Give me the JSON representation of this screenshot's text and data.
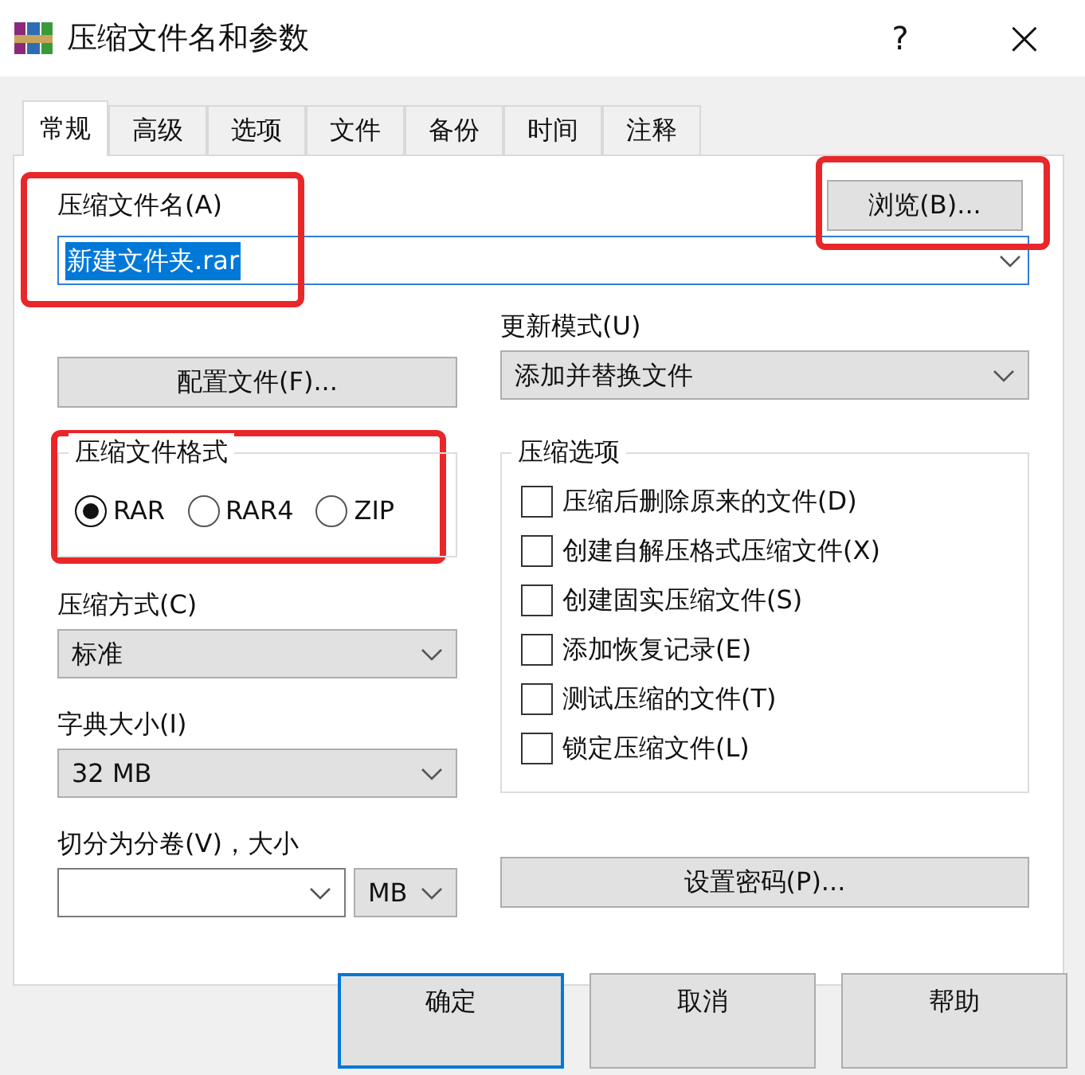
{
  "window": {
    "title": "压缩文件名和参数",
    "help": "?",
    "close": "×"
  },
  "tabs": [
    {
      "label": "常规",
      "selected": true
    },
    {
      "label": "高级",
      "selected": false
    },
    {
      "label": "选项",
      "selected": false
    },
    {
      "label": "文件",
      "selected": false
    },
    {
      "label": "备份",
      "selected": false
    },
    {
      "label": "时间",
      "selected": false
    },
    {
      "label": "注释",
      "selected": false
    }
  ],
  "archive_name": {
    "label": "压缩文件名(A)",
    "value": "新建文件夹.rar",
    "highlighted": true
  },
  "browse_button": {
    "label": "浏览(B)...",
    "highlighted": true
  },
  "profiles_button": {
    "label": "配置文件(F)..."
  },
  "update_mode": {
    "label": "更新模式(U)",
    "value": "添加并替换文件"
  },
  "archive_format": {
    "label": "压缩文件格式",
    "highlighted": true,
    "options": [
      {
        "label": "RAR",
        "selected": true
      },
      {
        "label": "RAR4",
        "selected": false
      },
      {
        "label": "ZIP",
        "selected": false
      }
    ]
  },
  "compression_method": {
    "label": "压缩方式(C)",
    "value": "标准"
  },
  "dictionary_size": {
    "label": "字典大小(I)",
    "value": "32 MB"
  },
  "split_volumes": {
    "label": "切分为分卷(V)，大小",
    "unit": "MB"
  },
  "archiving_options": {
    "label": "压缩选项",
    "items": [
      {
        "label": "压缩后删除原来的文件(D)",
        "checked": false
      },
      {
        "label": "创建自解压格式压缩文件(X)",
        "checked": false
      },
      {
        "label": "创建固实压缩文件(S)",
        "checked": false
      },
      {
        "label": "添加恢复记录(E)",
        "checked": false
      },
      {
        "label": "测试压缩的文件(T)",
        "checked": false
      },
      {
        "label": "锁定压缩文件(L)",
        "checked": false
      }
    ]
  },
  "password_button": {
    "label": "设置密码(P)..."
  },
  "buttons": [
    {
      "label": "确定",
      "default": true
    },
    {
      "label": "取消",
      "default": false
    },
    {
      "label": "帮助",
      "default": false
    }
  ]
}
